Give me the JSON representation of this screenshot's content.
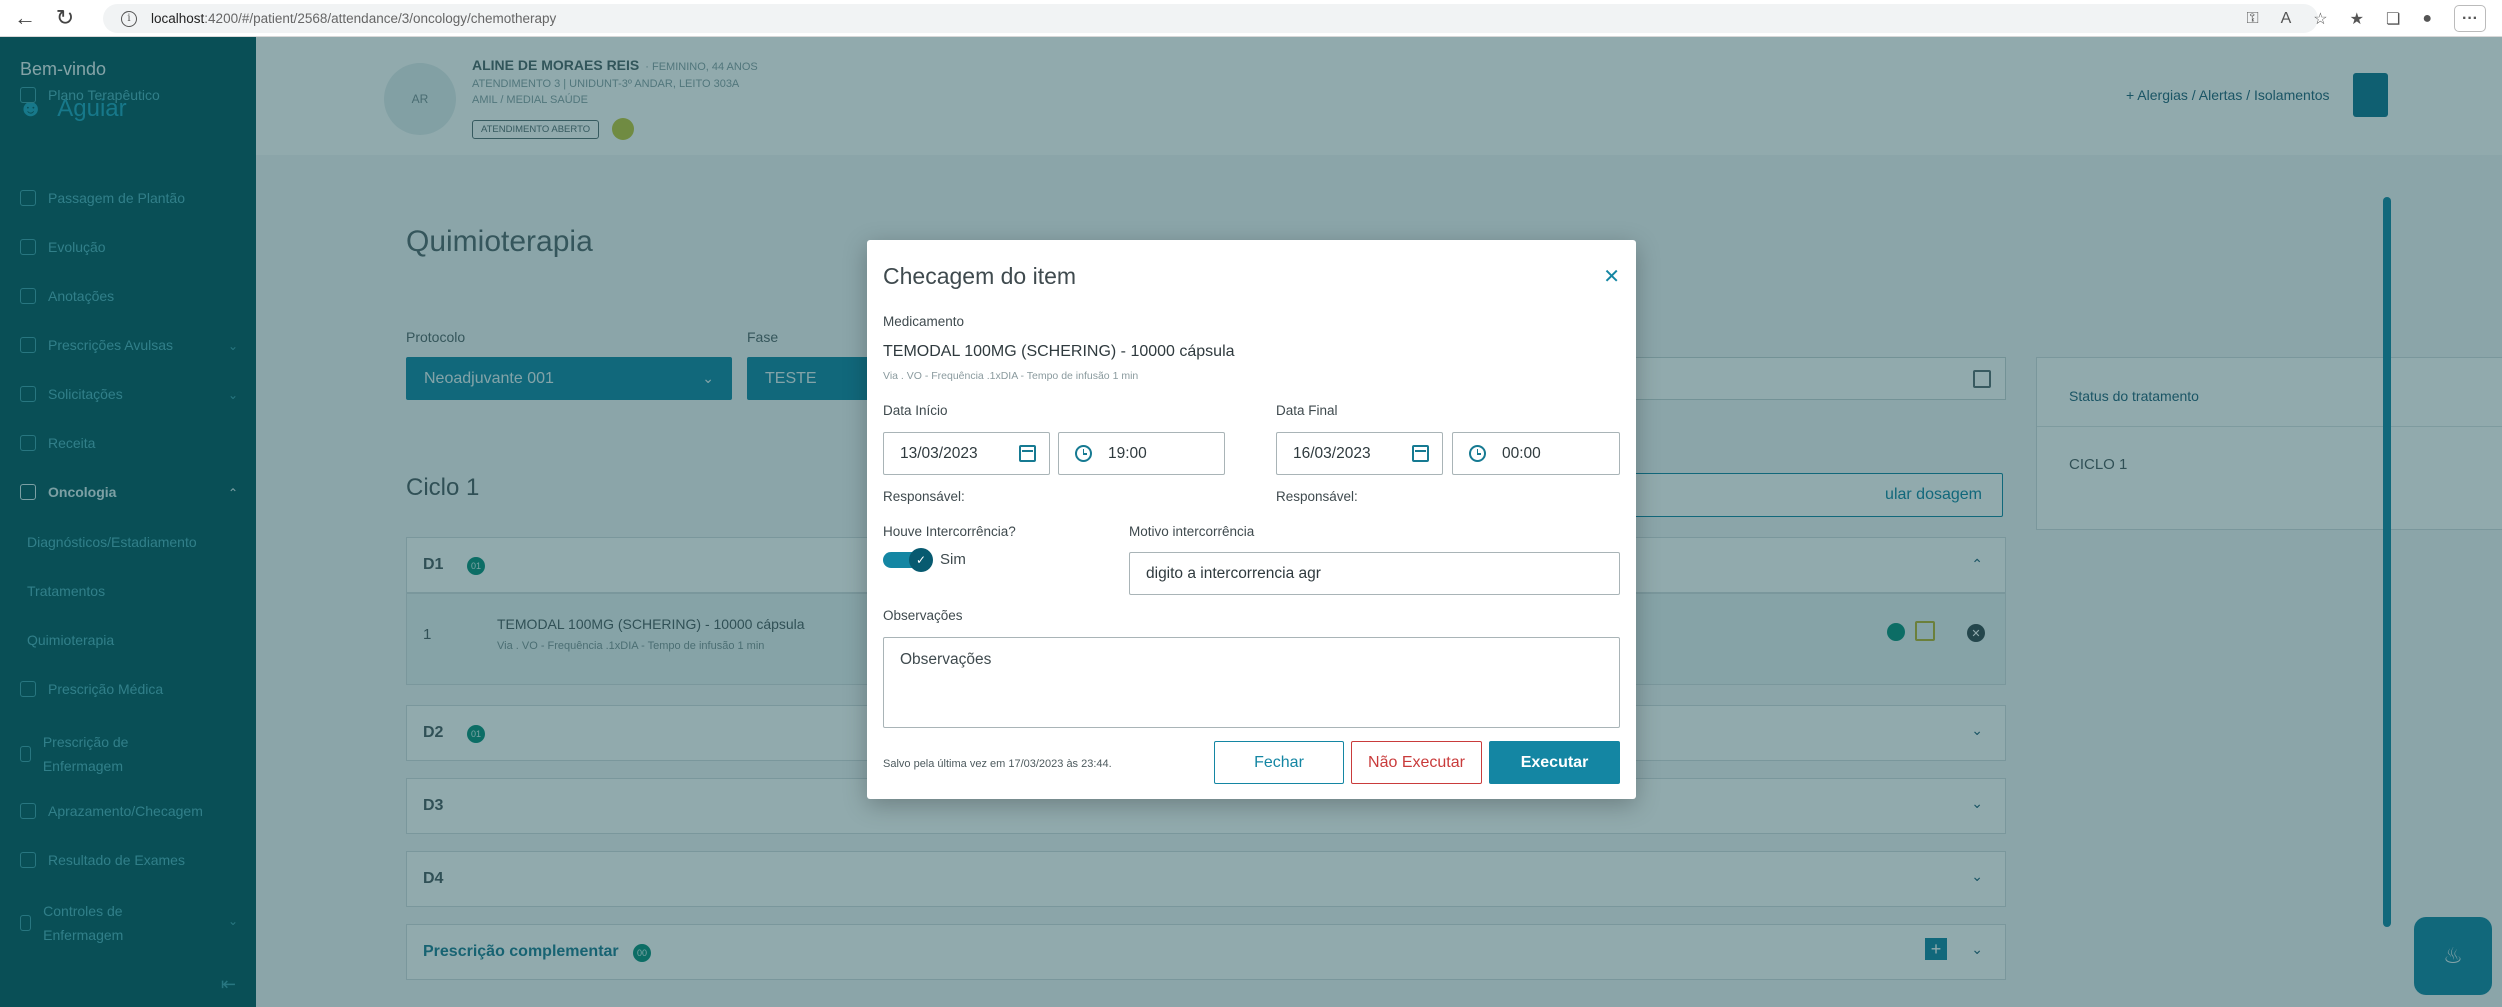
{
  "browser": {
    "url_host": "localhost",
    "url_path": ":4200/#/patient/2568/attendance/3/oncology/chemotherapy",
    "more_label": "···"
  },
  "sidebar": {
    "welcome": "Bem-vindo",
    "user": "Aguiar",
    "items": [
      {
        "label": "Plano Terapêutico"
      },
      {
        "label": "Passagem de Plantão"
      },
      {
        "label": "Evolução"
      },
      {
        "label": "Anotações"
      },
      {
        "label": "Prescrições Avulsas"
      },
      {
        "label": "Solicitações"
      },
      {
        "label": "Receita"
      },
      {
        "label": "Oncologia"
      },
      {
        "label": "Diagnósticos/Estadiamento"
      },
      {
        "label": "Tratamentos"
      },
      {
        "label": "Quimioterapia"
      },
      {
        "label": "Prescrição Médica"
      },
      {
        "label": "Prescrição de Enfermagem"
      },
      {
        "label": "Aprazamento/Checagem"
      },
      {
        "label": "Resultado de Exames"
      },
      {
        "label": "Controles de Enfermagem"
      }
    ]
  },
  "patient": {
    "initials": "AR",
    "name": "ALINE DE MORAES REIS",
    "meta": "· FEMININO, 44 ANOS",
    "line1": "ATENDIMENTO 3 | UNIDUNT-3º ANDAR, LEITO 303A",
    "line2": "AMIL / MEDIAL SAÚDE",
    "status": "ATENDIMENTO ABERTO",
    "alerts_link": "+  Alergias / Alertas / Isolamentos"
  },
  "page": {
    "title": "Quimioterapia",
    "protocol_label": "Protocolo",
    "protocol_value": "Neoadjuvante 001",
    "phase_label": "Fase",
    "phase_value": "TESTE",
    "cycle_title": "Ciclo 1",
    "calc_button": "ular dosagem",
    "days": [
      {
        "label": "D1",
        "count": "01"
      },
      {
        "label": "D2",
        "count": "01"
      },
      {
        "label": "D3"
      },
      {
        "label": "D4"
      }
    ],
    "med_row": {
      "num": "1",
      "name": "TEMODAL 100MG (SCHERING) - 10000 cápsula",
      "sub": "Via . VO - Frequência .1xDIA - Tempo de infusão 1 min"
    },
    "complementar": {
      "label": "Prescrição complementar",
      "count": "00"
    },
    "status_panel": {
      "title": "Status do tratamento",
      "cycle": "CICLO 1"
    }
  },
  "modal": {
    "title": "Checagem do item",
    "medication_label": "Medicamento",
    "medication_name": "TEMODAL 100MG (SCHERING) - 10000 cápsula",
    "medication_sub": "Via . VO - Frequência .1xDIA - Tempo de infusão 1 min",
    "start_label": "Data Início",
    "start_date": "13/03/2023",
    "start_time": "19:00",
    "end_label": "Data Final",
    "end_date": "16/03/2023",
    "end_time": "00:00",
    "responsible_label": "Responsável:",
    "intercurrence_label": "Houve Intercorrência?",
    "intercurrence_value": "Sim",
    "intercurrence_on": true,
    "reason_label": "Motivo intercorrência",
    "reason_value": "digito a intercorrencia agr",
    "notes_label": "Observações",
    "notes_placeholder": "Observações",
    "saved_text": "Salvo pela última vez em 17/03/2023 às 23:44.",
    "btn_close": "Fechar",
    "btn_not_execute": "Não Executar",
    "btn_execute": "Executar"
  }
}
